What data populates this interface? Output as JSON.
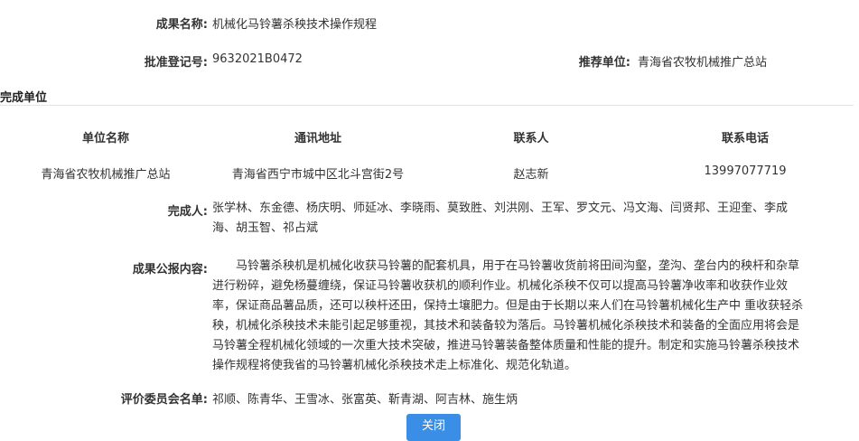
{
  "fields": {
    "name_label": "成果名称:",
    "name_value": "机械化马铃薯杀秧技术操作规程",
    "reg_label": "批准登记号:",
    "reg_value": "9632021B0472",
    "recommend_label": "推荐单位:",
    "recommend_value": "青海省农牧机械推广总站"
  },
  "unit_section": {
    "title": "完成单位",
    "headers": [
      "单位名称",
      "通讯地址",
      "联系人",
      "联系电话"
    ],
    "row": [
      "青海省农牧机械推广总站",
      "青海省西宁市城中区北斗宫街2号",
      "赵志新",
      "13997077719"
    ]
  },
  "people": {
    "label": "完成人:",
    "line1": "张学林、东金德、杨庆明、师延冰、李晓雨、莫致胜、刘洪刚、王军、罗文元、冯文海、闫贤邦、王迎奎、李成",
    "line2": "海、胡玉智、祁占斌"
  },
  "content": {
    "label": "成果公报内容:",
    "lines": [
      "　　马铃薯杀秧机是机械化收获马铃薯的配套机具，用于在马铃薯收货前将田间沟壑，垄沟、垄台内的秧杆和杂草",
      "进行粉碎，避免杨蔓缠绕，保证马铃薯收获机的顺利作业。机械化杀秧不仅可以提高马铃薯净收率和收获作业效",
      "率，保证商品薯品质，还可以秧杆还田，保持土壤肥力。但是由于长期以来人们在马铃薯机械化生产中 重收获轻杀",
      "秧，机械化杀秧技术未能引起足够重视，其技术和装备较为落后。马铃薯机械化杀秧技术和装备的全面应用将会是",
      "马铃薯全程机械化领域的一次重大技术突破，推进马铃薯装备整体质量和性能的提升。制定和实施马铃薯杀秧技术",
      "操作规程将使我省的马铃薯机械化杀秧技术走上标准化、规范化轨道。"
    ]
  },
  "committee": {
    "label": "评价委员会名单:",
    "value": "祁顺、陈青华、王雪冰、张富英、靳青湖、阿吉林、施生炳"
  },
  "close_button": "关闭"
}
